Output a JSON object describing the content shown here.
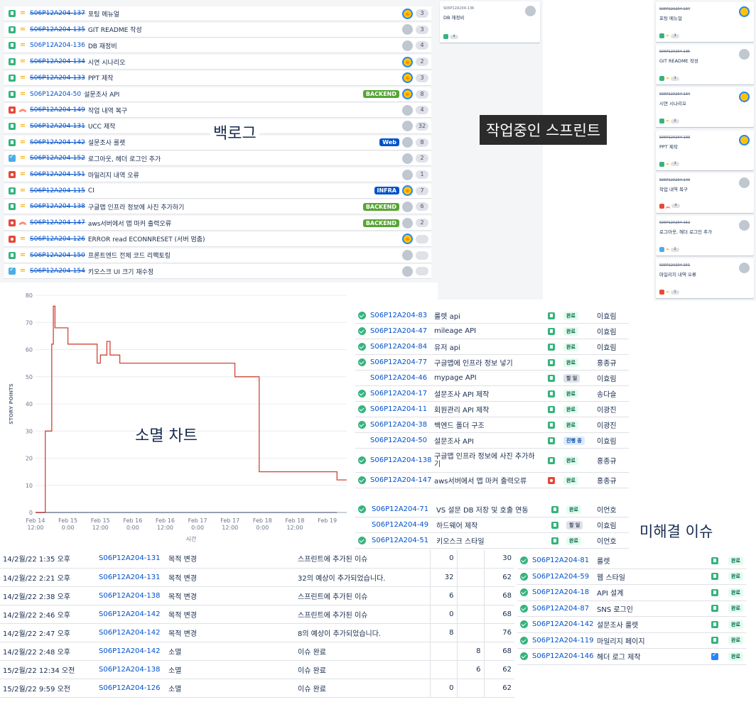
{
  "backlog": {
    "label": "백로그",
    "rows": [
      {
        "type": "story",
        "prio": "medium",
        "key": "S06P12A204-137",
        "done": true,
        "summary": "포팅 메뉴얼",
        "label": "",
        "label_color": "",
        "avatar": "fox",
        "points": "3"
      },
      {
        "type": "story",
        "prio": "medium",
        "key": "S06P12A204-135",
        "done": true,
        "summary": "GIT README 작성",
        "label": "",
        "label_color": "",
        "avatar": "grey",
        "points": "3"
      },
      {
        "type": "story",
        "prio": "medium",
        "key": "S06P12A204-136",
        "done": false,
        "summary": "DB 재정비",
        "label": "",
        "label_color": "",
        "avatar": "grey",
        "points": "4"
      },
      {
        "type": "story",
        "prio": "medium",
        "key": "S06P12A204-134",
        "done": true,
        "summary": "시연 시나리오",
        "label": "",
        "label_color": "",
        "avatar": "fox",
        "points": "2"
      },
      {
        "type": "story",
        "prio": "medium",
        "key": "S06P12A204-133",
        "done": true,
        "summary": "PPT 제작",
        "label": "",
        "label_color": "",
        "avatar": "fox",
        "points": "3"
      },
      {
        "type": "story",
        "prio": "medium",
        "key": "S06P12A204-50",
        "done": false,
        "summary": "설문조사 API",
        "label": "BACKEND",
        "label_color": "green",
        "avatar": "fox",
        "points": "8"
      },
      {
        "type": "bug",
        "prio": "high",
        "key": "S06P12A204-149",
        "done": true,
        "summary": "작업 내역 복구",
        "label": "",
        "label_color": "",
        "avatar": "grey",
        "points": "4"
      },
      {
        "type": "story",
        "prio": "medium",
        "key": "S06P12A204-131",
        "done": true,
        "summary": "UCC 제작",
        "label": "",
        "label_color": "",
        "avatar": "grey",
        "points": "32"
      },
      {
        "type": "story",
        "prio": "medium",
        "key": "S06P12A204-142",
        "done": true,
        "summary": "설문조사 룰렛",
        "label": "Web",
        "label_color": "blue",
        "avatar": "grey",
        "points": "8"
      },
      {
        "type": "task",
        "prio": "medium",
        "key": "S06P12A204-152",
        "done": true,
        "summary": "로그아웃, 헤더 로그인 추가",
        "label": "",
        "label_color": "",
        "avatar": "grey",
        "points": "2"
      },
      {
        "type": "bug",
        "prio": "medium",
        "key": "S06P12A204-151",
        "done": true,
        "summary": "마일리지 내역 오류",
        "label": "",
        "label_color": "",
        "avatar": "grey",
        "points": "1"
      },
      {
        "type": "story",
        "prio": "medium",
        "key": "S06P12A204-115",
        "done": true,
        "summary": "CI",
        "label": "INFRA",
        "label_color": "blue",
        "avatar": "fox",
        "points": "7"
      },
      {
        "type": "story",
        "prio": "medium",
        "key": "S06P12A204-138",
        "done": true,
        "summary": "구글맵 인프라 정보에 사진 추가하기",
        "label": "BACKEND",
        "label_color": "green",
        "avatar": "grey",
        "points": "6"
      },
      {
        "type": "bug",
        "prio": "high",
        "key": "S06P12A204-147",
        "done": true,
        "summary": "aws서버에서 맵 마커 출력오류",
        "label": "BACKEND",
        "label_color": "green",
        "avatar": "grey",
        "points": "2"
      },
      {
        "type": "bug",
        "prio": "medium",
        "key": "S06P12A204-126",
        "done": true,
        "summary": "ERROR read ECONNRESET (서버 멈춤)",
        "label": "",
        "label_color": "",
        "avatar": "fox",
        "points": ""
      },
      {
        "type": "story",
        "prio": "medium",
        "key": "S06P12A204-150",
        "done": true,
        "summary": "프론트엔드 전체 코드 리팩토링",
        "label": "",
        "label_color": "",
        "avatar": "grey",
        "points": ""
      },
      {
        "type": "task",
        "prio": "medium",
        "key": "S06P12A204-154",
        "done": true,
        "summary": "키오스크 UI 크기 재수정",
        "label": "",
        "label_color": "",
        "avatar": "grey",
        "points": ""
      }
    ]
  },
  "sprint": {
    "label": "작업중인 스프린트",
    "mid_card": {
      "key": "S06P12A204-136",
      "summary": "DB 재정비",
      "points": "4"
    },
    "cards": [
      {
        "key": "S06P12A204-137",
        "summary": "포팅 메뉴얼",
        "type": "story",
        "prio": "=",
        "points": "3",
        "avatar": "fox"
      },
      {
        "key": "S06P12A204-135",
        "summary": "GIT README 작성",
        "type": "story",
        "prio": "=",
        "points": "3",
        "avatar": "grey"
      },
      {
        "key": "S06P12A204-134",
        "summary": "시연 시나리오",
        "type": "story",
        "prio": "=",
        "points": "2",
        "avatar": "fox"
      },
      {
        "key": "S06P12A204-133",
        "summary": "PPT 제작",
        "type": "story",
        "prio": "=",
        "points": "3",
        "avatar": "fox"
      },
      {
        "key": "S06P12A204-149",
        "summary": "작업 내역 복구",
        "type": "bug",
        "prio": "^",
        "points": "4",
        "avatar": "grey"
      },
      {
        "key": "S06P12A204-152",
        "summary": "로그아웃, 헤더 로그인 추가",
        "type": "task",
        "prio": "=",
        "points": "2",
        "avatar": "grey"
      },
      {
        "key": "S06P12A204-151",
        "summary": "마일리지 내역 오류",
        "type": "bug",
        "prio": "=",
        "points": "1",
        "avatar": "grey"
      }
    ]
  },
  "burndown": {
    "label": "소멸 차트"
  },
  "chart_data": {
    "type": "line",
    "ylabel": "STORY POINTS",
    "xlabel": "시간",
    "ylim": [
      0,
      80
    ],
    "yticks": [
      0,
      10,
      20,
      30,
      40,
      50,
      60,
      70,
      80
    ],
    "xticks": [
      [
        "Feb 14",
        "12:00"
      ],
      [
        "Feb 15",
        "0:00"
      ],
      [
        "Feb 15",
        "12:00"
      ],
      [
        "Feb 16",
        "0:00"
      ],
      [
        "Feb 16",
        "12:00"
      ],
      [
        "Feb 17",
        "0:00"
      ],
      [
        "Feb 17",
        "12:00"
      ],
      [
        "Feb 18",
        "0:00"
      ],
      [
        "Feb 18",
        "12:00"
      ],
      [
        "Feb 19",
        ""
      ]
    ],
    "x": [
      0,
      0.3,
      0.3,
      0.5,
      0.5,
      0.55,
      0.55,
      0.6,
      0.6,
      0.7,
      0.7,
      1.0,
      1.0,
      1.9,
      1.9,
      2.0,
      2.0,
      2.2,
      2.2,
      2.3,
      2.3,
      2.45,
      2.45,
      2.6,
      2.6,
      3.0,
      3.0,
      6.15,
      6.15,
      6.9,
      6.9,
      9.3,
      9.3,
      9.6
    ],
    "y": [
      0,
      0,
      30,
      30,
      62,
      62,
      76,
      76,
      68,
      68,
      68,
      68,
      62,
      62,
      55,
      55,
      58,
      58,
      63,
      63,
      58,
      58,
      58,
      58,
      55,
      55,
      55,
      55,
      50,
      50,
      15,
      15,
      12,
      12
    ]
  },
  "issues1": {
    "rows": [
      {
        "chk": true,
        "key": "S06P12A204-83",
        "summary": "룰렛 api",
        "type": "story",
        "status": "완료",
        "status_color": "green",
        "assignee": "이효림"
      },
      {
        "chk": true,
        "key": "S06P12A204-47",
        "summary": "mileage API",
        "type": "story",
        "status": "완료",
        "status_color": "green",
        "assignee": "이효림"
      },
      {
        "chk": true,
        "key": "S06P12A204-84",
        "summary": "유저 api",
        "type": "story",
        "status": "완료",
        "status_color": "green",
        "assignee": "이효림"
      },
      {
        "chk": true,
        "key": "S06P12A204-77",
        "summary": "구글맵에 인프라 정보 넣기",
        "type": "story",
        "status": "완료",
        "status_color": "green",
        "assignee": "홍종규"
      },
      {
        "chk": false,
        "key": "S06P12A204-46",
        "summary": "mypage API",
        "type": "story",
        "status": "할 일",
        "status_color": "grey",
        "assignee": "이효림"
      },
      {
        "chk": true,
        "key": "S06P12A204-17",
        "summary": "설문조사 API 제작",
        "type": "story",
        "status": "완료",
        "status_color": "green",
        "assignee": "송다슬"
      },
      {
        "chk": true,
        "key": "S06P12A204-11",
        "summary": "회원관리 API 제작",
        "type": "story",
        "status": "완료",
        "status_color": "green",
        "assignee": "이광진"
      },
      {
        "chk": true,
        "key": "S06P12A204-38",
        "summary": "백엔드 폴더 구조",
        "type": "story",
        "status": "완료",
        "status_color": "green",
        "assignee": "이광진"
      },
      {
        "chk": false,
        "key": "S06P12A204-50",
        "summary": "설문조사 API",
        "type": "story",
        "status": "진행 중",
        "status_color": "blue",
        "assignee": "이효림"
      },
      {
        "chk": true,
        "key": "S06P12A204-138",
        "summary": "구글맵 인프라 정보에 사진 추가하기",
        "type": "story",
        "status": "완료",
        "status_color": "green",
        "assignee": "홍종규"
      },
      {
        "chk": true,
        "key": "S06P12A204-147",
        "summary": "aws서버에서 맵 마커 출력오류",
        "type": "bug",
        "status": "완료",
        "status_color": "green",
        "assignee": "홍종규"
      }
    ]
  },
  "issues2": {
    "label": "미해결 이슈",
    "rows": [
      {
        "chk": true,
        "key": "S06P12A204-71",
        "summary": "VS 설문 DB 저장 및 호출 연동",
        "type": "story",
        "status": "완료",
        "status_color": "green",
        "assignee": "이언호"
      },
      {
        "chk": false,
        "key": "S06P12A204-49",
        "summary": "하드웨어 제작",
        "type": "story",
        "status": "할 일",
        "status_color": "grey",
        "assignee": "이효림"
      },
      {
        "chk": true,
        "key": "S06P12A204-51",
        "summary": "키오스크 스타일",
        "type": "story",
        "status": "완료",
        "status_color": "green",
        "assignee": "이언호"
      }
    ]
  },
  "log": {
    "rows": [
      {
        "date": "14/2월/22 1:35 오후",
        "key": "S06P12A204-131",
        "event": "목적 변경",
        "detail": "스프린트에 추가된 이슈",
        "a": "0",
        "b": "",
        "c": "30"
      },
      {
        "date": "14/2월/22 2:21 오후",
        "key": "S06P12A204-131",
        "event": "목적 변경",
        "detail": "32의 예상이 추가되었습니다.",
        "a": "32",
        "b": "",
        "c": "62"
      },
      {
        "date": "14/2월/22 2:38 오후",
        "key": "S06P12A204-138",
        "event": "목적 변경",
        "detail": "스프린트에 추가된 이슈",
        "a": "6",
        "b": "",
        "c": "68"
      },
      {
        "date": "14/2월/22 2:46 오후",
        "key": "S06P12A204-142",
        "event": "목적 변경",
        "detail": "스프린트에 추가된 이슈",
        "a": "0",
        "b": "",
        "c": "68"
      },
      {
        "date": "14/2월/22 2:47 오후",
        "key": "S06P12A204-142",
        "event": "목적 변경",
        "detail": "8의 예상이 추가되었습니다.",
        "a": "8",
        "b": "",
        "c": "76"
      },
      {
        "date": "14/2월/22 2:48 오후",
        "key": "S06P12A204-142",
        "event": "소멸",
        "detail": "이슈 완료",
        "a": "",
        "b": "8",
        "c": "68"
      },
      {
        "date": "15/2월/22 12:34 오전",
        "key": "S06P12A204-138",
        "event": "소멸",
        "detail": "이슈 완료",
        "a": "",
        "b": "6",
        "c": "62"
      },
      {
        "date": "15/2월/22 9:59 오전",
        "key": "S06P12A204-126",
        "event": "소멸",
        "detail": "이슈 완료",
        "a": "0",
        "b": "",
        "c": "62"
      }
    ]
  },
  "issues3": {
    "rows": [
      {
        "chk": true,
        "key": "S06P12A204-81",
        "summary": "룰렛",
        "type": "story",
        "status": "완료",
        "status_color": "green"
      },
      {
        "chk": true,
        "key": "S06P12A204-59",
        "summary": "웹 스타일",
        "type": "story",
        "status": "완료",
        "status_color": "green"
      },
      {
        "chk": true,
        "key": "S06P12A204-18",
        "summary": "API 설계",
        "type": "story",
        "status": "완료",
        "status_color": "green"
      },
      {
        "chk": true,
        "key": "S06P12A204-87",
        "summary": "SNS 로그인",
        "type": "story",
        "status": "완료",
        "status_color": "green"
      },
      {
        "chk": true,
        "key": "S06P12A204-142",
        "summary": "설문조사 룰렛",
        "type": "story",
        "status": "완료",
        "status_color": "green"
      },
      {
        "chk": true,
        "key": "S06P12A204-119",
        "summary": "마일리지 페이지",
        "type": "story",
        "status": "완료",
        "status_color": "green"
      },
      {
        "chk": true,
        "key": "S06P12A204-146",
        "summary": "헤더 로그 제작",
        "type": "task",
        "status": "완료",
        "status_color": "green"
      }
    ]
  }
}
